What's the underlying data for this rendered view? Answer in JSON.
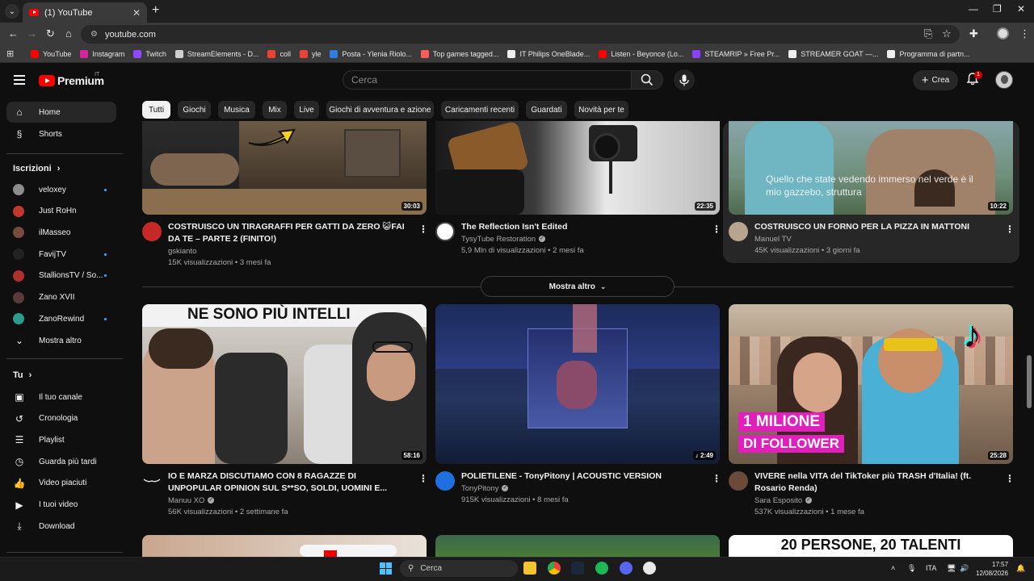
{
  "browser": {
    "tab_title": "(1) YouTube",
    "url": "youtube.com",
    "bookmarks": [
      {
        "label": "YouTube",
        "color": "#ff0000"
      },
      {
        "label": "Instagram",
        "color": "#d6249f"
      },
      {
        "label": "Twitch",
        "color": "#9146ff"
      },
      {
        "label": "StreamElements - D...",
        "color": "#cfcfcf"
      },
      {
        "label": "coll",
        "color": "#ea4335"
      },
      {
        "label": "yle",
        "color": "#ea4335"
      },
      {
        "label": "Posta - Ylenia Riolo...",
        "color": "#2f7de1"
      },
      {
        "label": "Top games tagged...",
        "color": "#fa5c5c"
      },
      {
        "label": "IT Philips OneBlade...",
        "color": "#eeeeee"
      },
      {
        "label": "Listen - Beyonce (Lo...",
        "color": "#ff0000"
      },
      {
        "label": "STEAMRIP » Free Pr...",
        "color": "#8a3ffc"
      },
      {
        "label": "STREAMER GOAT —...",
        "color": "#eeeeee"
      },
      {
        "label": "Programma di partn...",
        "color": "#eeeeee"
      }
    ]
  },
  "header": {
    "logo_text": "Premium",
    "country": "IT",
    "search_placeholder": "Cerca",
    "create_label": "Crea",
    "notification_count": "1"
  },
  "sidebar": {
    "main": [
      {
        "label": "Home",
        "icon": "home-icon"
      },
      {
        "label": "Shorts",
        "icon": "shorts-icon"
      }
    ],
    "subscriptions_title": "Iscrizioni",
    "subscriptions": [
      {
        "label": "veloxey",
        "color": "#8d8d8d"
      },
      {
        "label": "Just RoHn",
        "color": "#c0392b"
      },
      {
        "label": "ilMasseo",
        "color": "#7a4a3a"
      },
      {
        "label": "FavijTV",
        "color": "#222222"
      },
      {
        "label": "StallionsTV / So...",
        "color": "#b03030"
      },
      {
        "label": "Zano XVII",
        "color": "#5a3a3a"
      },
      {
        "label": "ZanoRewind",
        "color": "#2e9c8a"
      }
    ],
    "show_more": "Mostra altro",
    "you_title": "Tu",
    "you_items": [
      {
        "label": "Il tuo canale",
        "icon": "channel-icon"
      },
      {
        "label": "Cronologia",
        "icon": "history-icon"
      },
      {
        "label": "Playlist",
        "icon": "playlist-icon"
      },
      {
        "label": "Guarda più tardi",
        "icon": "watch-later-icon"
      },
      {
        "label": "Video piaciuti",
        "icon": "like-icon"
      },
      {
        "label": "I tuoi video",
        "icon": "your-videos-icon"
      },
      {
        "label": "Download",
        "icon": "download-icon"
      }
    ]
  },
  "chips": [
    "Tutti",
    "Giochi",
    "Musica",
    "Mix",
    "Live",
    "Giochi di avventura e azione",
    "Caricamenti recenti",
    "Guardati",
    "Novità per te"
  ],
  "row1": [
    {
      "title": "COSTRUISCO UN TIRAGRAFFI PER GATTI DA ZERO 😺FAI DA TE – PARTE 2 (FINITO!)",
      "channel": "gskianto",
      "meta": "15K visualizzazioni • 3 mesi fa",
      "duration": "30:03"
    },
    {
      "title": "The Reflection Isn't Edited",
      "channel": "TysyTube Restoration",
      "meta": "5,9 Mln di visualizzazioni • 2 mesi fa",
      "duration": "22:35"
    },
    {
      "title": "COSTRUISCO UN FORNO PER LA PIZZA IN MATTONI",
      "channel": "Manuel TV",
      "meta": "45K visualizzazioni • 3 giorni fa",
      "duration": "10:22",
      "overlay": "Quello che state vedendo immerso nel verde è il mio gazzebo, struttura"
    }
  ],
  "show_more_button": "Mostra altro",
  "row2": [
    {
      "title": "IO E MARZA DISCUTIAMO CON 8 RAGAZZE DI UNPOPULAR OPINION SUL S**SO, SOLDI, UOMINI E...",
      "channel": "Manuu XO",
      "meta": "56K visualizzazioni • 2 settimane fa",
      "duration": "58:16",
      "thumb_text": "NE SONO PIÙ INTELLI"
    },
    {
      "title": "POLIETILENE - TonyPitony | ACOUSTIC VERSION",
      "channel": "TonyPitony",
      "meta": "915K visualizzazioni • 8 mesi fa",
      "duration": "♪ 2:49"
    },
    {
      "title": "VIVERE nella VITA del TikToker più TRASH d'Italia! (ft. Rosario Renda)",
      "channel": "Sara Esposito",
      "meta": "537K visualizzazioni • 1 mese fa",
      "duration": "25:28",
      "thumb_text_1": "1 MILIONE",
      "thumb_text_2": "DI FOLLOWER"
    }
  ],
  "row3_thumb_text": "20 PERSONE, 20 TALENTI",
  "taskbar": {
    "search": "Cerca",
    "lang": "ITA",
    "time": "17:57",
    "date": "12/08/2026"
  }
}
